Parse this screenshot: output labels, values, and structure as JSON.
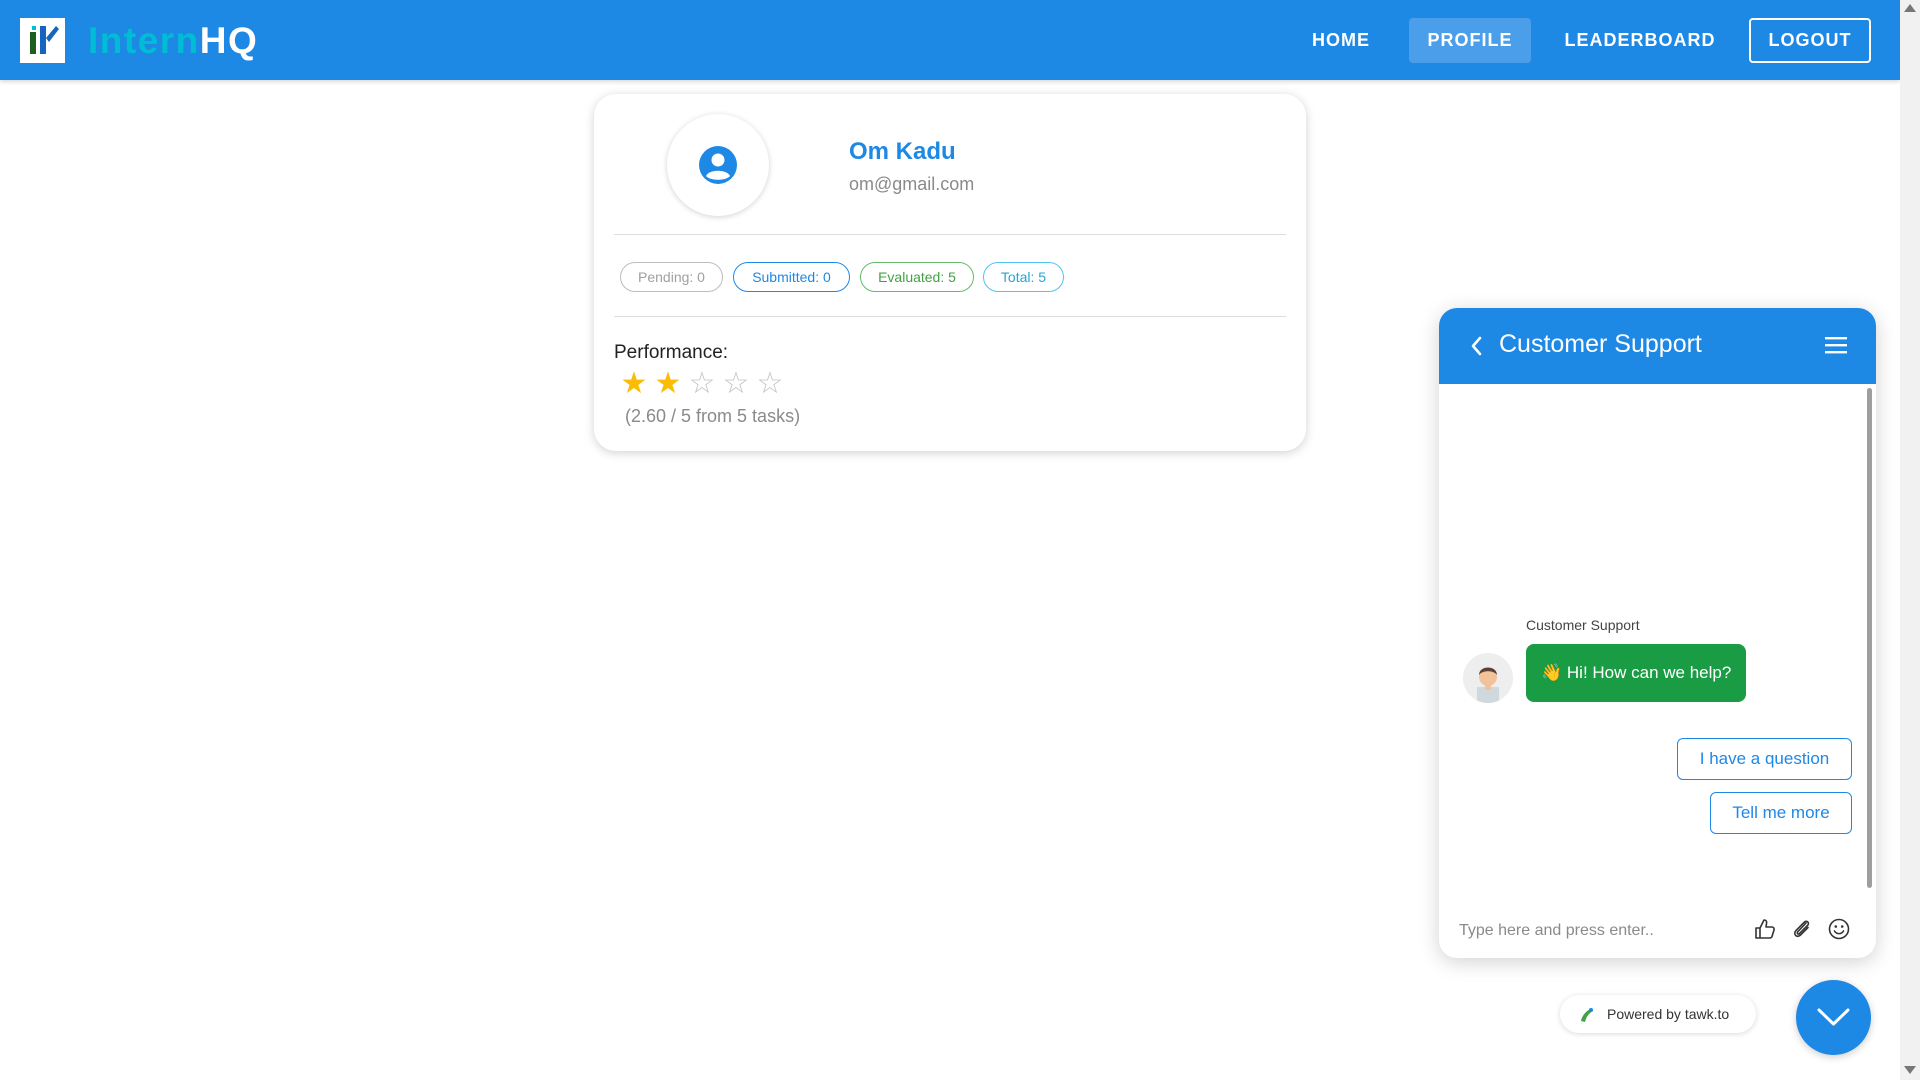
{
  "brand": {
    "part1": "Intern",
    "part2": "HQ"
  },
  "nav": {
    "home": "HOME",
    "profile": "PROFILE",
    "leaderboard": "LEADERBOARD",
    "logout": "LOGOUT"
  },
  "profile": {
    "name": "Om Kadu",
    "email": "om@gmail.com",
    "chips": {
      "pending": "Pending: 0",
      "submitted": "Submitted: 0",
      "evaluated": "Evaluated: 5",
      "total": "Total: 5"
    },
    "performance_label": "Performance:",
    "rating": {
      "stars_filled": 2,
      "stars_total": 5
    },
    "performance_summary": "(2.60 / 5 from 5 tasks)"
  },
  "chat": {
    "title": "Customer Support",
    "agent_name": "Customer Support",
    "message": "👋 Hi! How can we help?",
    "options": [
      "I have a question",
      "Tell me more"
    ],
    "input_placeholder": "Type here and press enter..",
    "powered_by": "Powered by tawk.to"
  },
  "colors": {
    "primary": "#1e88e5",
    "brand_accent": "#00bcd4",
    "chat_bubble": "#1a9c44",
    "star": "#fbbc05"
  },
  "icons": [
    "user-circle-icon",
    "chevron-left-icon",
    "hamburger-menu-icon",
    "thumbs-up-icon",
    "paperclip-icon",
    "emoji-icon",
    "chevron-down-icon",
    "tawk-logo-icon"
  ]
}
